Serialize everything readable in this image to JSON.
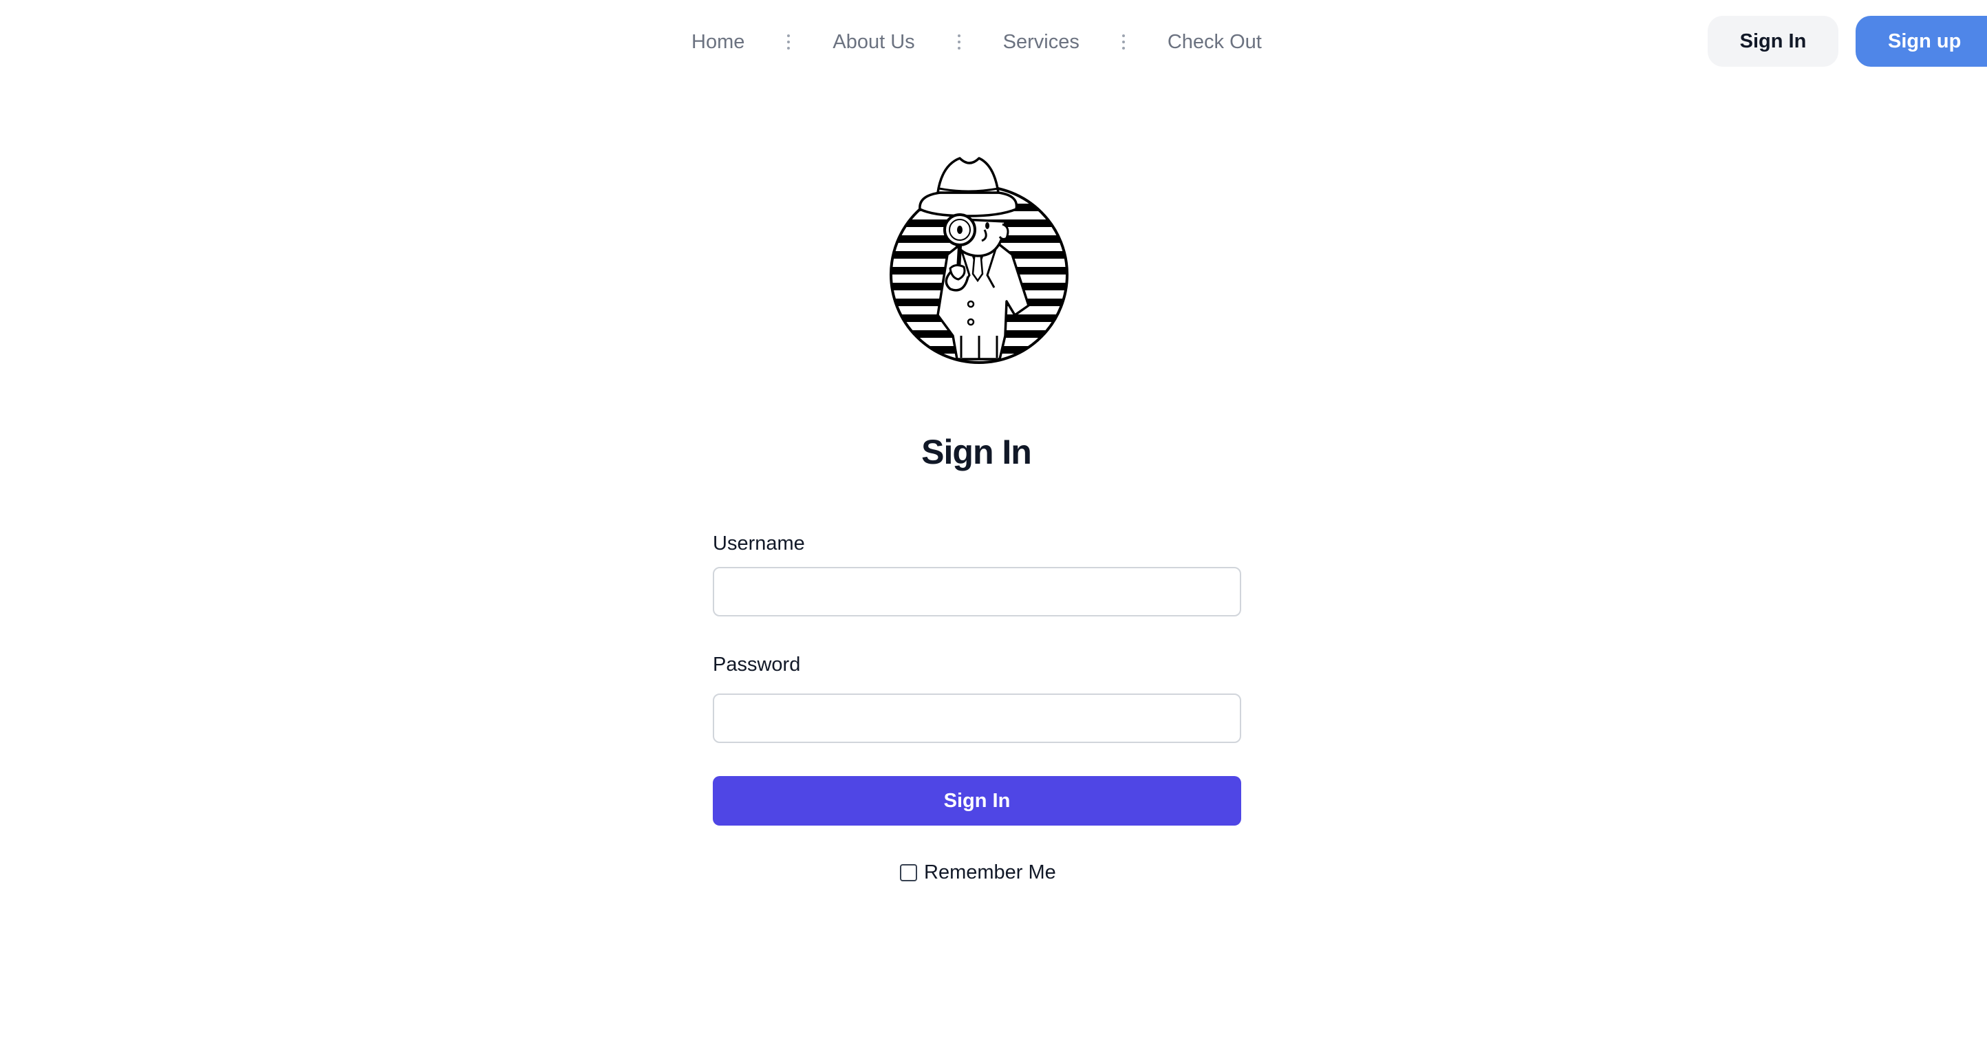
{
  "nav": {
    "links": [
      {
        "label": "Home"
      },
      {
        "label": "About Us"
      },
      {
        "label": "Services"
      },
      {
        "label": "Check Out"
      }
    ],
    "signin_label": "Sign In",
    "signup_label": "Sign up"
  },
  "logo": {
    "icon": "detective-with-magnifying-glass-icon"
  },
  "form": {
    "title": "Sign In",
    "username_label": "Username",
    "username_value": "",
    "password_label": "Password",
    "password_value": "",
    "submit_label": "Sign In",
    "remember_label": "Remember Me",
    "remember_checked": false
  },
  "colors": {
    "primary_button": "#4f46e5",
    "signup_button": "#4f86e8",
    "nav_text": "#6b7280"
  }
}
